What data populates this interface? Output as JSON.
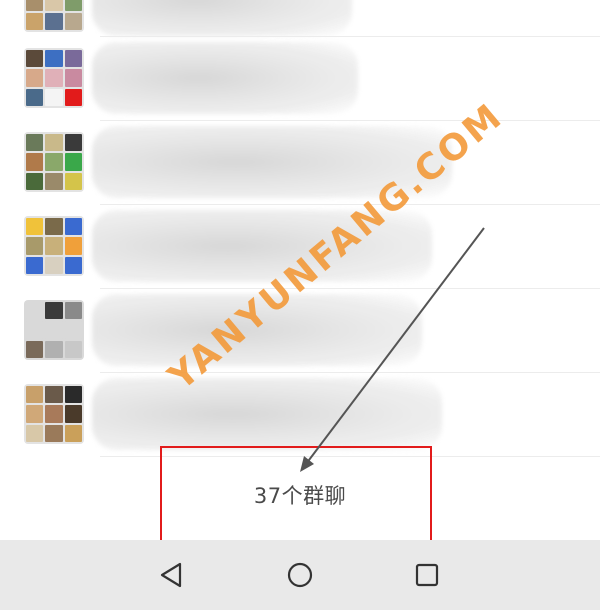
{
  "group_list": {
    "count_label": "37个群聊"
  },
  "watermark": {
    "text": "YANYUNFANG.COM"
  },
  "nav_bar": {
    "back_icon": "back-triangle-icon",
    "home_icon": "home-circle-icon",
    "recents_icon": "recents-square-icon"
  },
  "colors": {
    "highlight": "#e21b1b",
    "watermark": "#f39a3a",
    "navbar_bg": "#e9e9e9"
  }
}
